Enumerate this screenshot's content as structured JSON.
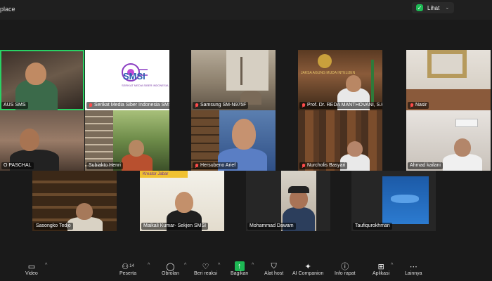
{
  "window": {
    "title": "place"
  },
  "security": {
    "label": "Lihat"
  },
  "participants": [
    {
      "name": "AUS SMS",
      "muted": false
    },
    {
      "name": "Serikat Media Siber Indonesia SMSI",
      "muted": true
    },
    {
      "name": "Samsung SM-N975F",
      "muted": true
    },
    {
      "name": "Prof. Dr. REDA MANTHOVANI, S.H., LL.M.",
      "muted": true
    },
    {
      "name": "Nasir",
      "muted": true
    },
    {
      "name": "O PASCHAL",
      "muted": false
    },
    {
      "name": "Subiakto Henri",
      "muted": false
    },
    {
      "name": "Hersubeno Arief",
      "muted": true
    },
    {
      "name": "Nurcholis Basyari",
      "muted": true
    },
    {
      "name": "Ahmad kailani",
      "muted": false
    },
    {
      "name": "Sasongko Tedjo",
      "muted": false
    },
    {
      "name": "Maikali Kumar- Sekjen SMSI",
      "muted": false
    },
    {
      "name": "Mohammad Dawam",
      "muted": false
    },
    {
      "name": "Taufiqurokhman",
      "muted": false
    }
  ],
  "tile_text": {
    "smsi_logo": "SMSI",
    "smsi_tagline": "SERIKAT MEDIA SIBER INDONESIA",
    "kreator_banner": "Kreator Jabar",
    "plaque": "JAKSA AGUNG MUDA INTELIJEN"
  },
  "toolbar": {
    "video": "Video",
    "participants": "Peserta",
    "participants_count": "14",
    "chat": "Obrolan",
    "reactions": "Beri reaksi",
    "share": "Bagikan",
    "host_tools": "Alat host",
    "ai_companion": "AI Companion",
    "meeting_info": "Info rapat",
    "apps": "Aplikasi",
    "more": "Lainnya"
  },
  "colors": {
    "active_speaker": "#29d164",
    "share_green": "#1db954",
    "muted_red": "#ff4b4b"
  },
  "icons": [
    "shield-check-icon",
    "mic-muted-icon",
    "video-off-icon",
    "participants-icon",
    "chat-icon",
    "heart-icon",
    "share-screen-icon",
    "shield-icon",
    "sparkle-icon",
    "info-icon",
    "apps-icon",
    "more-icon"
  ]
}
